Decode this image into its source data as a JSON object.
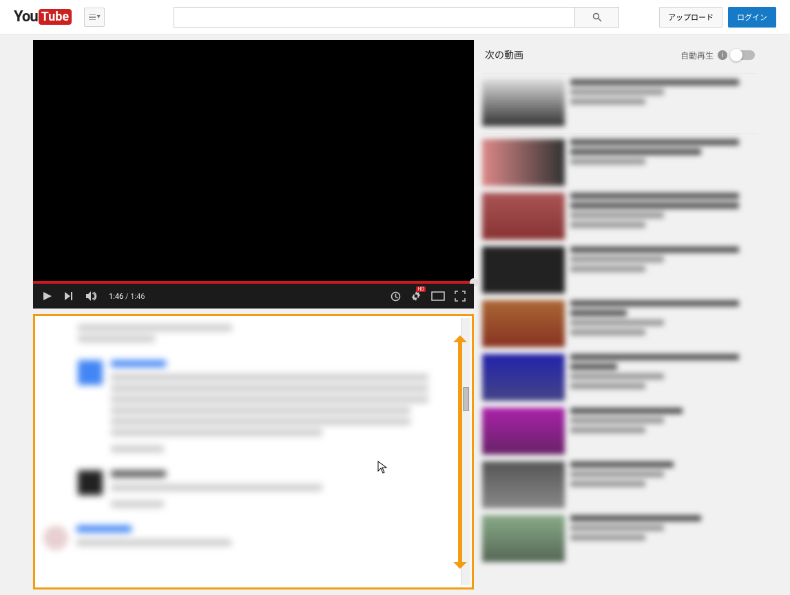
{
  "header": {
    "logo_you": "You",
    "logo_tube": "Tube",
    "search_placeholder": "",
    "upload_label": "アップロード",
    "login_label": "ログイン"
  },
  "player": {
    "current_time": "1:46",
    "total_time": "1:46",
    "hd_badge": "HD"
  },
  "sidebar": {
    "next_label": "次の動画",
    "autoplay_label": "自動再生",
    "info_glyph": "i"
  }
}
